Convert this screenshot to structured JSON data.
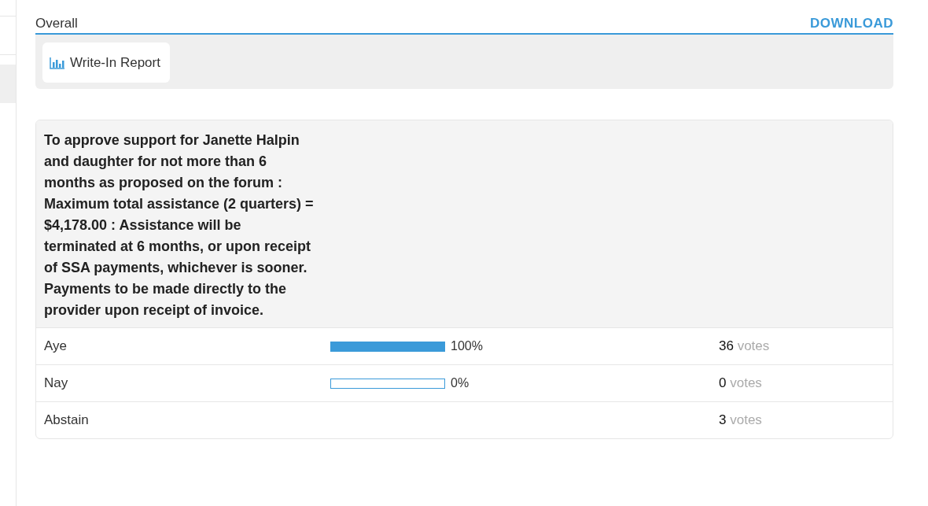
{
  "section": {
    "title": "Overall",
    "download": "DOWNLOAD"
  },
  "report_button": {
    "label": "Write-In Report"
  },
  "question": {
    "text": "To approve support for Janette Halpin and daughter for not more than 6 months as proposed on the forum : Maximum total assistance (2 quarters) = $4,178.00 : Assistance will be terminated at 6 months, or upon receipt of SSA payments, whichever is sooner. Payments to be made directly to the provider upon receipt of invoice.",
    "options": [
      {
        "kind": "bar",
        "label": "Aye",
        "level": 1,
        "percent": "100%",
        "count": "36",
        "unit": "votes"
      },
      {
        "kind": "bar",
        "label": "Nay",
        "level": 0,
        "percent": "0%",
        "count": "0",
        "unit": "votes"
      },
      {
        "kind": "plain",
        "label": "Abstain",
        "count": "3",
        "unit": "votes"
      }
    ]
  }
}
